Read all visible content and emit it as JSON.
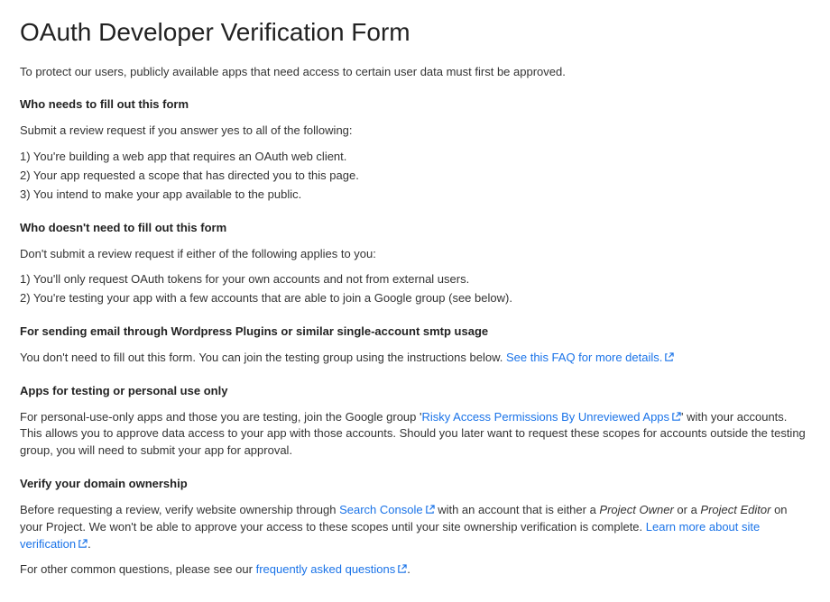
{
  "title": "OAuth Developer Verification Form",
  "intro": "To protect our users, publicly available apps that need access to certain user data must first be approved.",
  "sections": {
    "who_needs": {
      "heading": "Who needs to fill out this form",
      "lead": "Submit a review request if you answer yes to all of the following:",
      "items": [
        "1) You're building a web app that requires an OAuth web client.",
        "2) Your app requested a scope that has directed you to this page.",
        "3) You intend to make your app available to the public."
      ]
    },
    "who_doesnt": {
      "heading": "Who doesn't need to fill out this form",
      "lead": "Don't submit a review request if either of the following applies to you:",
      "items": [
        "1) You'll only request OAuth tokens for your own accounts and not from external users.",
        "2) You're testing your app with a few accounts that are able to join a Google group (see below)."
      ]
    },
    "wordpress": {
      "heading": "For sending email through Wordpress Plugins or similar single-account smtp usage",
      "text_before_link": "You don't need to fill out this form. You can join the testing group using the instructions below. ",
      "link_text": "See this FAQ for more details."
    },
    "testing": {
      "heading": "Apps for testing or personal use only",
      "text_before_link": "For personal-use-only apps and those you are testing, join the Google group '",
      "link_text": "Risky Access Permissions By Unreviewed Apps",
      "text_after_link": "' with your accounts. This allows you to approve data access to your app with those accounts. Should you later want to request these scopes for accounts outside the testing group, you will need to submit your app for approval."
    },
    "verify": {
      "heading": "Verify your domain ownership",
      "text_before_link1": "Before requesting a review, verify website ownership through ",
      "link1_text": "Search Console",
      "text_mid": " with an account that is either a ",
      "em1": "Project Owner",
      "text_mid2": " or a ",
      "em2": "Project Editor",
      "text_after_em": " on your Project. We won't be able to approve your access to these scopes until your site ownership verification is complete. ",
      "link2_text": "Learn more about site verification",
      "period": "."
    },
    "faq": {
      "text_before_link": "For other common questions, please see our ",
      "link_text": "frequently asked questions",
      "period": "."
    }
  }
}
